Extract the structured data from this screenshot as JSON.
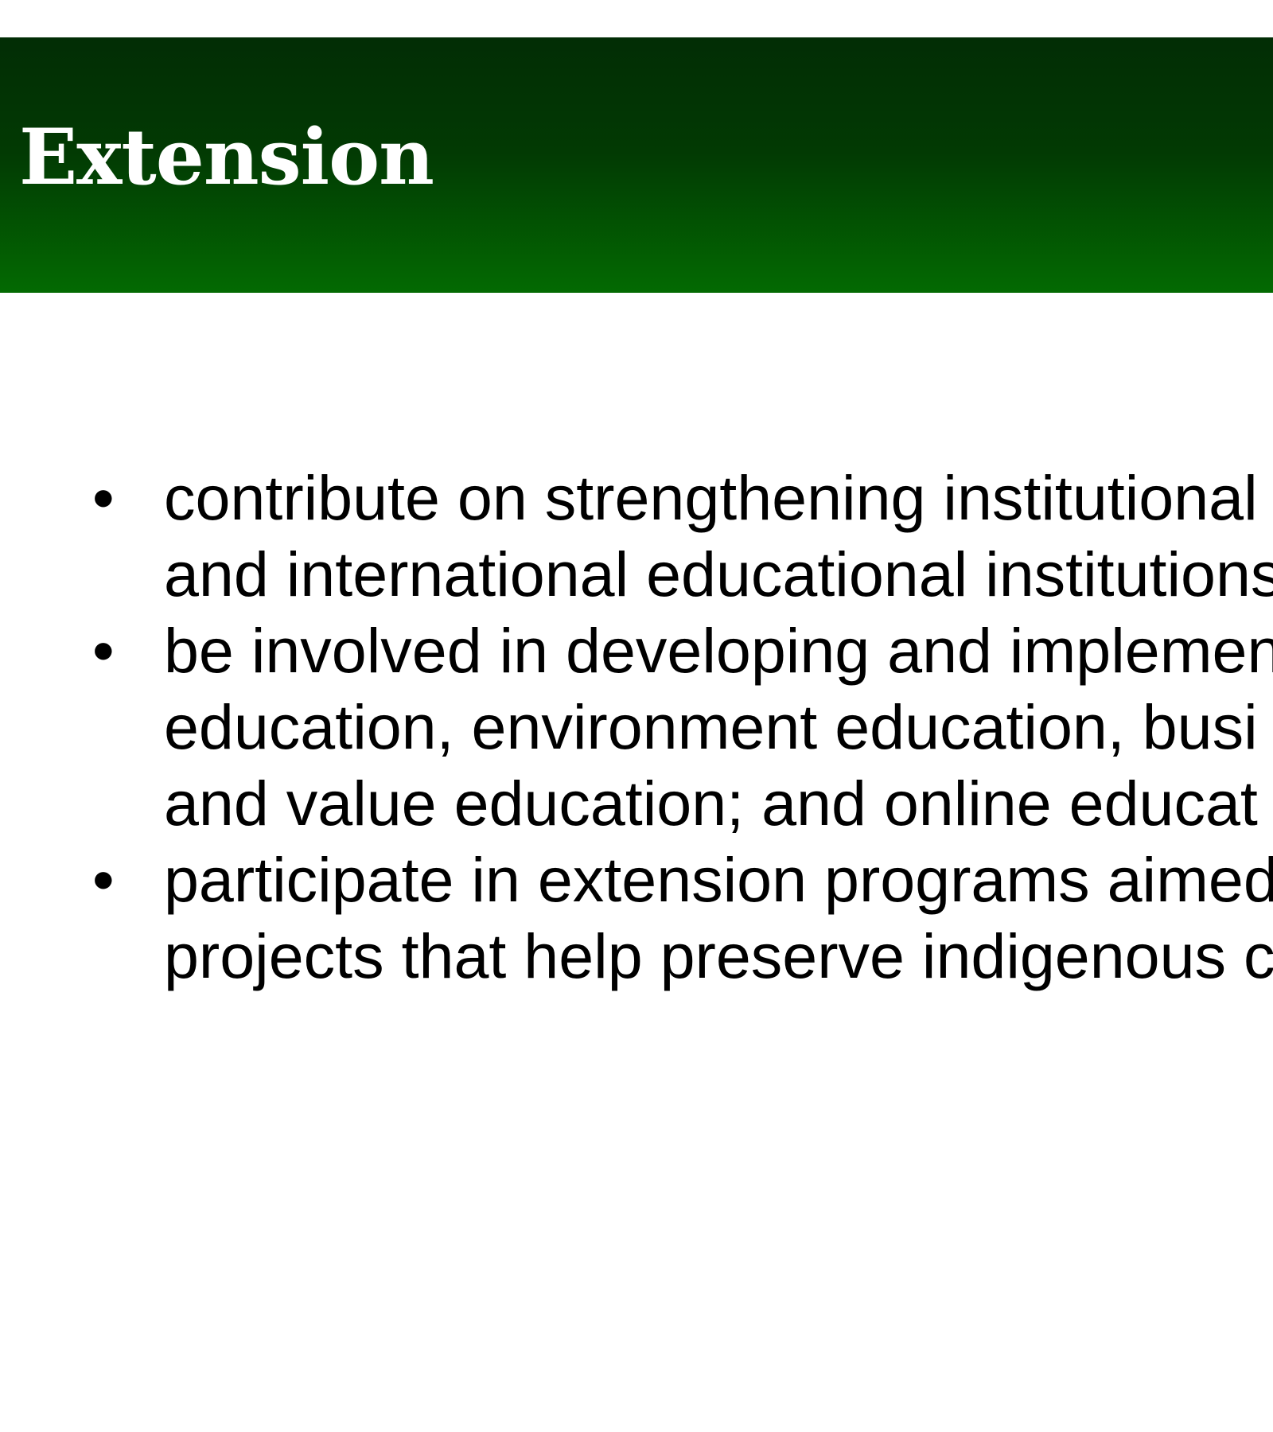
{
  "slide": {
    "title": "Extension",
    "header_colors": [
      "#022d05",
      "#036a02"
    ],
    "bullet_symbol": "•",
    "bullets": [
      {
        "lines": [
          "contribute on strengthening institutional",
          "and international educational institutions"
        ]
      },
      {
        "lines": [
          "be involved in developing and implemen",
          "education, environment education, busi",
          "and value education; and online educat"
        ]
      },
      {
        "lines": [
          "participate in extension programs aimed",
          "projects that help preserve indigenous c"
        ]
      }
    ]
  }
}
